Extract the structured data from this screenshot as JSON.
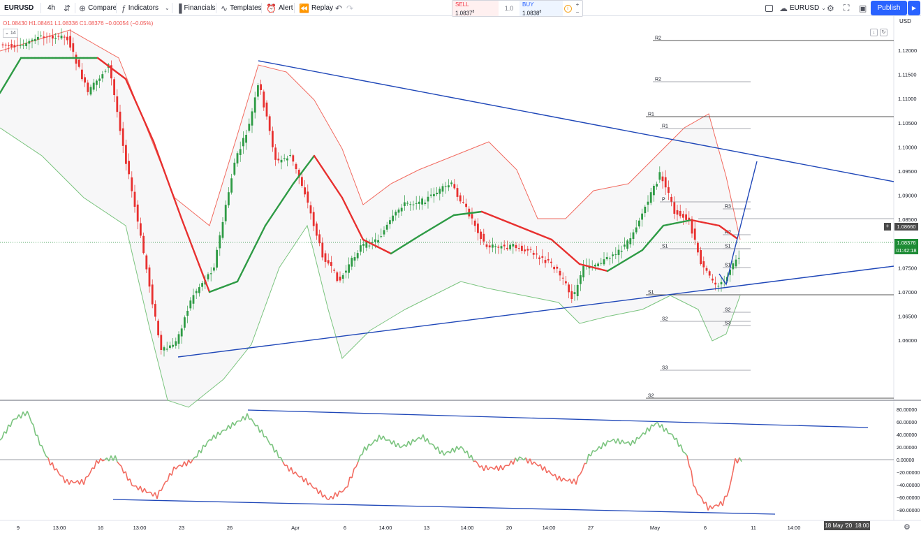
{
  "toolbar": {
    "symbol": "EURUSD",
    "interval": "4h",
    "compare": "Compare",
    "indicators": "Indicators",
    "financials": "Financials",
    "templates": "Templates",
    "alert": "Alert",
    "replay": "Replay",
    "sell_label": "SELL",
    "sell_price": "1.0837",
    "sell_sup": "8",
    "spread": "1.0",
    "buy_label": "BUY",
    "buy_price": "1.0838",
    "buy_sup": "8",
    "right_symbol": "EURUSD",
    "publish": "Publish"
  },
  "legend": {
    "ohlc": "O1.08430 H1.08461 L1.08336 C1.08376 −0.00054 (−0.05%)",
    "indicator_value": "14"
  },
  "price_axis": {
    "currency": "USD",
    "ticks": [
      "1.12000",
      "1.11500",
      "1.11000",
      "1.10500",
      "1.10000",
      "1.09500",
      "1.09000",
      "1.08500",
      "1.08000",
      "1.07500",
      "1.07000",
      "1.06500",
      "1.06000"
    ],
    "tag_alt": "1.08660",
    "tag_last": "1.08376",
    "tag_timer": "01:42:18"
  },
  "osc_axis": {
    "ticks": [
      "80.00000",
      "60.00000",
      "40.00000",
      "20.00000",
      "0.00000",
      "−20.00000",
      "−40.00000",
      "−60.00000",
      "−80.00000"
    ]
  },
  "time_axis": {
    "labels": [
      "9",
      "13:00",
      "16",
      "13:00",
      "23",
      "26",
      "Apr",
      "6",
      "14:00",
      "13",
      "14:00",
      "20",
      "14:00",
      "27",
      "May",
      "6",
      "11",
      "14:00",
      "14:00"
    ],
    "crosshair_date": "18 May '20",
    "crosshair_time": "18:00"
  },
  "pivots": [
    "R2",
    "R2",
    "R1",
    "R1",
    "P",
    "R3",
    "R2",
    "S1",
    "S1",
    "S1",
    "S1",
    "S2",
    "S2",
    "S3",
    "S3",
    "S2"
  ],
  "colors": {
    "bull": "#2e9b45",
    "bear": "#e8302f",
    "trendline": "#1f47b8",
    "accent": "#2962ff"
  }
}
